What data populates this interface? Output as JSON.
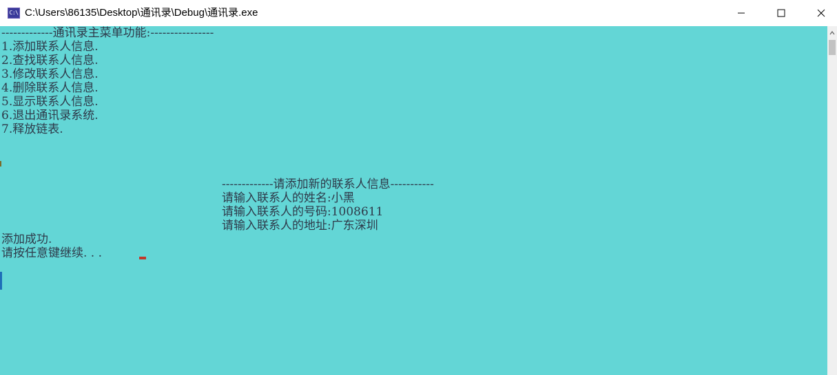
{
  "window": {
    "title": "C:\\Users\\86135\\Desktop\\通讯录\\Debug\\通讯录.exe",
    "icon_label": "C:\\",
    "icon_name": "console-app-icon"
  },
  "console": {
    "menu_header": "-------------通讯录主菜单功能:----------------",
    "menu_items": [
      "1.添加联系人信息.",
      "2.查找联系人信息.",
      "3.修改联系人信息.",
      "4.删除联系人信息.",
      "5.显示联系人信息.",
      "6.退出通讯录系统.",
      "7.释放链表."
    ],
    "add_header": "-------------请添加新的联系人信息-----------",
    "name_prompt": "请输入联系人的姓名:小黑",
    "phone_prompt": "请输入联系人的号码:1008611",
    "address_prompt": "请输入联系人的地址:广东深圳",
    "success_msg": "添加成功.",
    "continue_msg": "请按任意键继续. . ."
  },
  "colors": {
    "console_bg": "#63d6d6",
    "console_text": "#2e3a4a",
    "cursor": "#c0392b"
  }
}
